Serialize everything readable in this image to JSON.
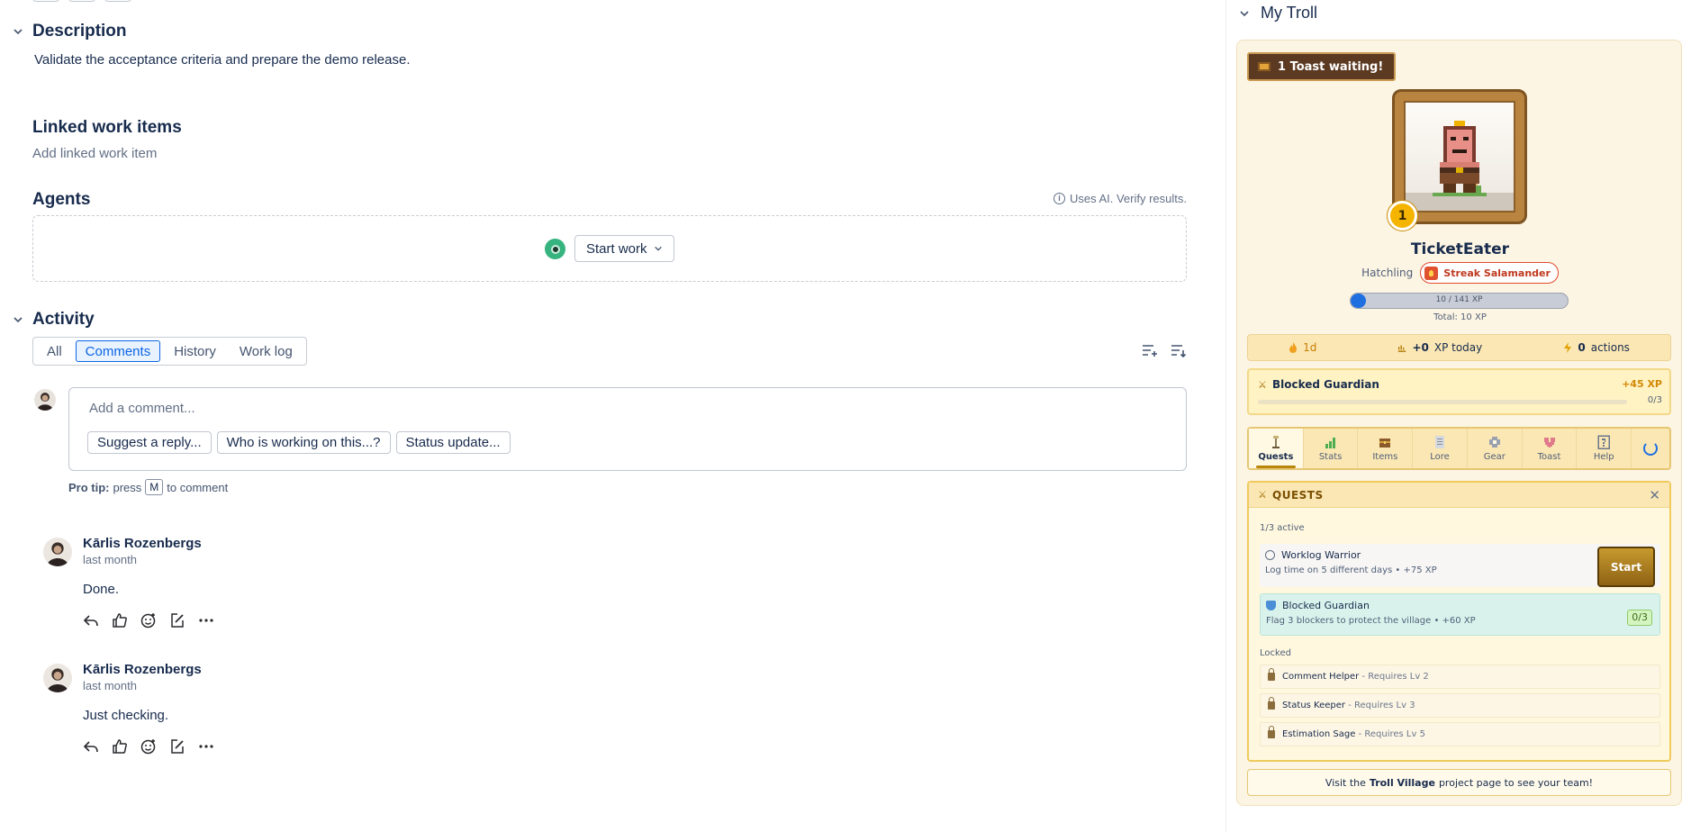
{
  "description": {
    "title": "Description",
    "text": "Validate the acceptance criteria and prepare the demo release."
  },
  "linked": {
    "title": "Linked work items",
    "add_label": "Add linked work item"
  },
  "agents": {
    "title": "Agents",
    "ai_note": "Uses AI. Verify results.",
    "start_work_label": "Start work"
  },
  "activity": {
    "title": "Activity",
    "tabs": [
      "All",
      "Comments",
      "History",
      "Work log"
    ],
    "active_tab": "Comments",
    "comment_placeholder": "Add a comment...",
    "suggestions": [
      "Suggest a reply...",
      "Who is working on this...?",
      "Status update..."
    ],
    "pro_tip_label": "Pro tip:",
    "pro_tip_press": "press",
    "pro_tip_key": "M",
    "pro_tip_suffix": "to comment",
    "comments": [
      {
        "author": "Kārlis Rozenbergs",
        "time": "last month",
        "body": "Done."
      },
      {
        "author": "Kārlis Rozenbergs",
        "time": "last month",
        "body": "Just checking."
      }
    ]
  },
  "troll": {
    "section_title": "My Troll",
    "toast_waiting": "1 Toast waiting!",
    "level": "1",
    "name": "TicketEater",
    "rank": "Hatchling",
    "streak_badge": "Streak Salamander",
    "xp_text": "10 / 141 XP",
    "xp_fraction": 0.071,
    "xp_total": "Total: 10 XP",
    "stats": {
      "streak": "1d",
      "xp_today_value": "+0",
      "xp_today_label": "XP today",
      "actions_value": "0",
      "actions_label": "actions"
    },
    "active_quest": {
      "title": "Blocked Guardian",
      "xp": "+45 XP",
      "progress": "0/3"
    },
    "tabs": [
      "Quests",
      "Stats",
      "Items",
      "Lore",
      "Gear",
      "Toast",
      "Help"
    ],
    "active_tab": "Quests",
    "quests_panel": {
      "title": "QUESTS",
      "active_count": "1/3 active",
      "quests": [
        {
          "name": "Worklog Warrior",
          "desc": "Log time on 5 different days • +75 XP",
          "button": "Start"
        },
        {
          "name": "Blocked Guardian",
          "desc": "Flag 3 blockers to protect the village • +60 XP",
          "count": "0/3"
        }
      ],
      "locked_label": "Locked",
      "locked": [
        {
          "name": "Comment Helper",
          "req": "- Requires Lv 2"
        },
        {
          "name": "Status Keeper",
          "req": "- Requires Lv 3"
        },
        {
          "name": "Estimation Sage",
          "req": "- Requires Lv 5"
        }
      ]
    },
    "village_prefix": "Visit the",
    "village_link": "Troll Village",
    "village_suffix": "project page to see your team!"
  },
  "colors": {
    "accent": "#0c66e4",
    "troll_card_bg": "#fdf5e3",
    "quest_gold": "#efca5c",
    "streak_red": "#e04b2e"
  }
}
